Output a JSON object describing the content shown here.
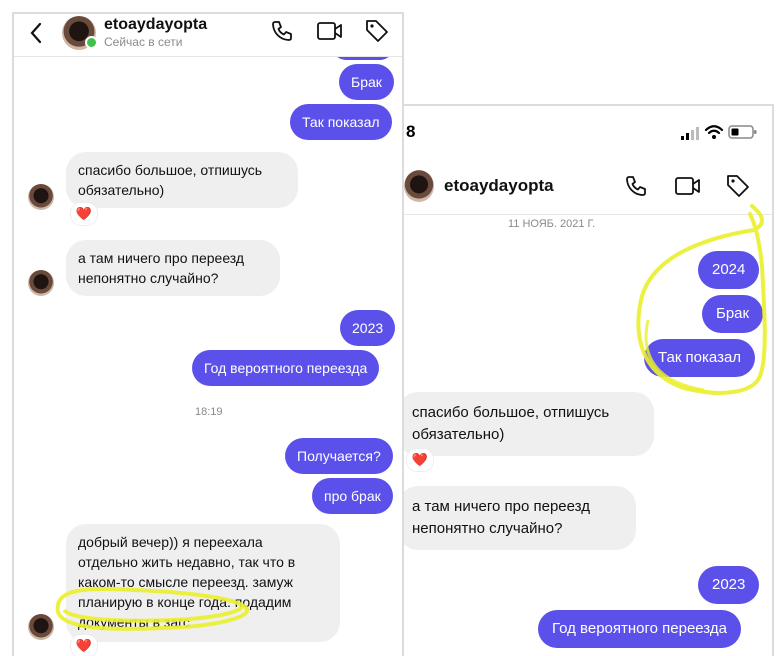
{
  "left": {
    "header": {
      "username": "etoaydayopta",
      "status": "Сейчас в сети"
    },
    "messages": [
      {
        "text": "Брак"
      },
      {
        "text": "Так показал"
      },
      {
        "text": "спасибо большое, отпишусь\nобязательно)",
        "reaction": "❤️"
      },
      {
        "text": "а там ничего про переезд\nнепонятно случайно?"
      },
      {
        "text": "2023"
      },
      {
        "text": "Год вероятного переезда"
      },
      {
        "text": "Получается?"
      },
      {
        "text": "про брак"
      },
      {
        "text": "добрый вечер)) я переехала\nотдельно жить недавно, так что в\nкаком-то смысле переезд. замуж\nпланирую в конце года. подадим\nдокументы в загс",
        "reaction": "❤️"
      }
    ],
    "timestamp": "18:19"
  },
  "right": {
    "status_bar": {
      "time": "8"
    },
    "header": {
      "username": "etoaydayopta"
    },
    "date": "11 НОЯБ. 2021 Г.",
    "messages": [
      {
        "text": "2024"
      },
      {
        "text": "Брак"
      },
      {
        "text": "Так показал"
      },
      {
        "text": "спасибо большое, отпишусь\nобязательно)",
        "reaction": "❤️"
      },
      {
        "text": "а там ничего про переезд\nнепонятно случайно?"
      },
      {
        "text": "2023"
      },
      {
        "text": "Год вероятного переезда"
      }
    ]
  },
  "colors": {
    "outgoing": "#5b51ea",
    "incoming": "#efefef",
    "highlight": "#eaf02a",
    "online": "#3dc24a"
  },
  "icons": [
    "back-icon",
    "phone-icon",
    "video-icon",
    "tag-icon",
    "heart-icon",
    "signal-icon",
    "wifi-icon",
    "battery-icon"
  ]
}
